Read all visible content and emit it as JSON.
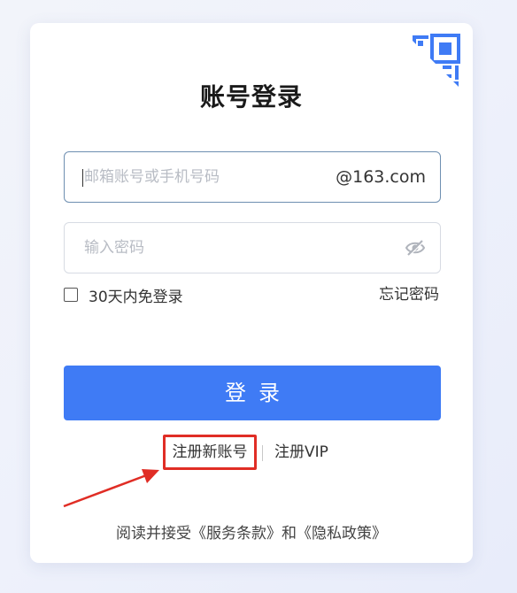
{
  "form": {
    "title": "账号登录",
    "account_placeholder": "邮箱账号或手机号码",
    "account_suffix": "@163.com",
    "password_placeholder": "输入密码",
    "remember_label": "30天内免登录",
    "forgot_label": "忘记密码",
    "login_label": "登录"
  },
  "links": {
    "register_new": "注册新账号",
    "register_vip": "注册VIP"
  },
  "terms": {
    "prefix": "阅读并接受",
    "service": "《服务条款》",
    "and": "和",
    "privacy": "《隐私政策》"
  },
  "icons": {
    "qr": "qr-code-icon",
    "eye": "eye-slash-icon",
    "checkbox": "checkbox-unchecked"
  },
  "colors": {
    "primary": "#3f7bf5",
    "highlight": "#e02d25"
  }
}
